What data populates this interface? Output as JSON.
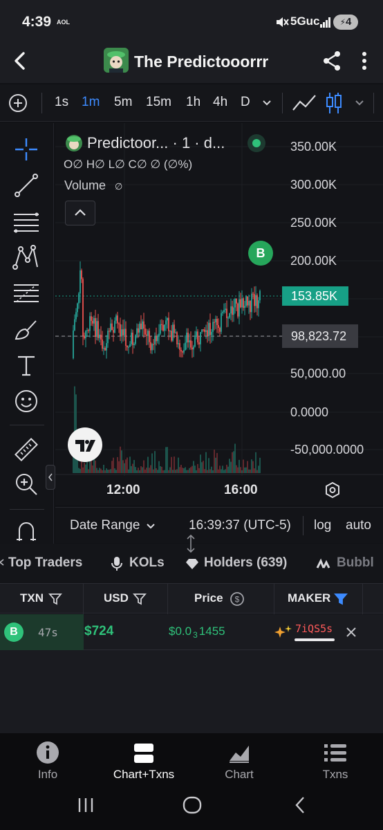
{
  "status_bar": {
    "time": "4:39",
    "carrier": "AOL",
    "network": "5Guc",
    "battery": "4"
  },
  "header": {
    "title": "The Predictooorrr"
  },
  "timeframes": {
    "items": [
      "1s",
      "1m",
      "5m",
      "15m",
      "1h",
      "4h",
      "D"
    ],
    "active": "1m"
  },
  "chart": {
    "legend_title": "Predictoor... · 1 · d...",
    "ohlc": "O∅ H∅ L∅ C∅ ∅ (∅%)",
    "volume_label": "Volume",
    "volume_value": "∅",
    "marker": "B",
    "current_price": "153.85K",
    "crosshair_price": "98,823.72",
    "price_axis": [
      "350.00K",
      "300.00K",
      "250.00K",
      "200.00K",
      "50,000.00",
      "0.0000",
      "-50,000.0000"
    ],
    "time_axis": [
      "12:00",
      "16:00"
    ],
    "accent_up": "#26a69a",
    "accent_down": "#ef5350"
  },
  "chart_bottom": {
    "date_range": "Date Range",
    "clock": "16:39:37 (UTC-5)",
    "log": "log",
    "auto": "auto"
  },
  "tabs": [
    "Top Traders",
    "KOLs",
    "Holders (639)",
    "Bubbl"
  ],
  "table": {
    "headers": {
      "txn": "TXN",
      "usd": "USD",
      "price": "Price",
      "maker": "MAKER"
    },
    "rows": [
      {
        "type": "B",
        "age": "47s",
        "usd": "$724",
        "price_prefix": "$0.0",
        "price_sub": "3",
        "price_rest": "1455",
        "maker": "7iQS5s"
      }
    ]
  },
  "bottom_nav": [
    "Info",
    "Chart+Txns",
    "Chart",
    "Txns"
  ],
  "colors": {
    "green": "#2fc27a",
    "blue": "#3d8bff",
    "teal": "#17a086"
  }
}
